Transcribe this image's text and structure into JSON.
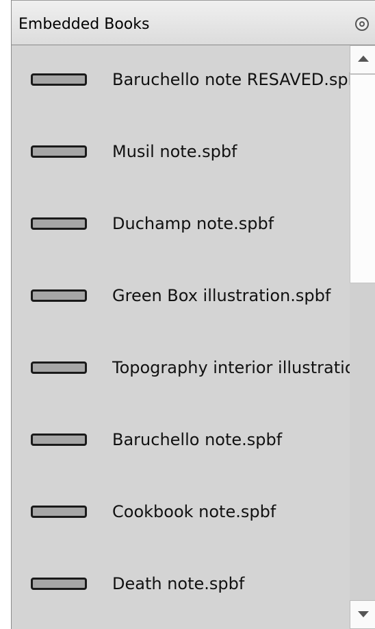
{
  "panel": {
    "title": "Embedded Books"
  },
  "items": [
    {
      "label": "Baruchello note RESAVED.spbf"
    },
    {
      "label": "Musil note.spbf"
    },
    {
      "label": "Duchamp note.spbf"
    },
    {
      "label": "Green Box illustration.spbf"
    },
    {
      "label": "Topography interior illustration.spbf"
    },
    {
      "label": "Baruchello note.spbf"
    },
    {
      "label": "Cookbook note.spbf"
    },
    {
      "label": "Death note.spbf"
    }
  ],
  "icons": {
    "close": "close-icon",
    "item": "book-icon",
    "scroll_up": "chevron-up-icon",
    "scroll_down": "chevron-down-icon"
  }
}
